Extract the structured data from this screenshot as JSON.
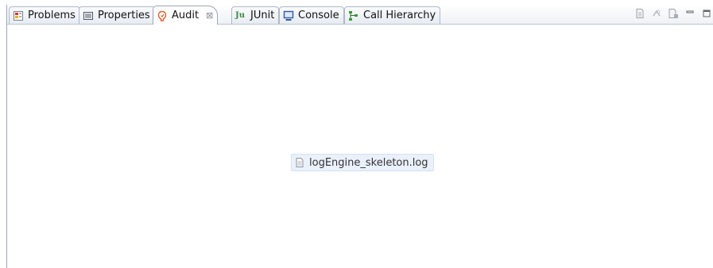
{
  "tabs": [
    {
      "label": "Problems",
      "icon": "problems-icon"
    },
    {
      "label": "Properties",
      "icon": "properties-icon"
    },
    {
      "label": "Audit",
      "icon": "audit-icon",
      "close": "⊠"
    },
    {
      "label": "JUnit",
      "icon": "junit-icon",
      "icon_text": "Ju"
    },
    {
      "label": "Console",
      "icon": "console-icon"
    },
    {
      "label": "Call Hierarchy",
      "icon": "call-hierarchy-icon"
    }
  ],
  "active_tab": "Audit",
  "toolbar": [
    "page-icon",
    "sync-icon",
    "export-icon",
    "minimize-icon",
    "maximize-icon"
  ],
  "content": {
    "log_file": "logEngine_skeleton.log",
    "log_icon": "file-icon"
  },
  "colors": {
    "accent": "#e05a2a",
    "junit_green": "#3a8a3a",
    "console_blue": "#2f5aa8",
    "selection": "#eaf1fb"
  }
}
